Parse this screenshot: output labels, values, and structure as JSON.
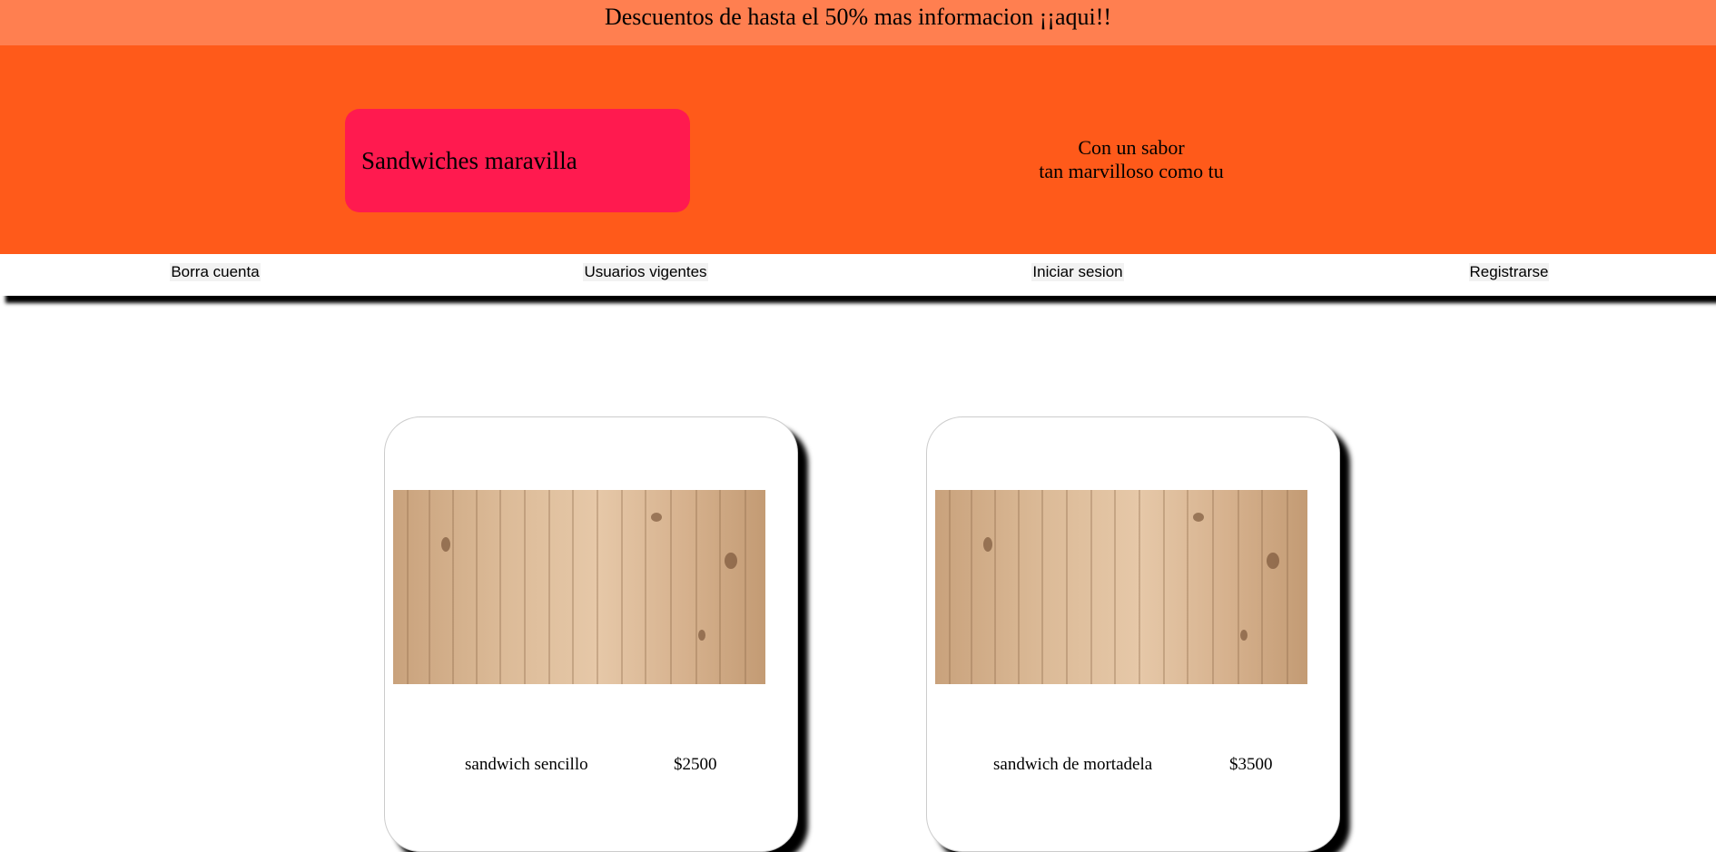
{
  "promo": {
    "text": "Descuentos de hasta el 50% mas informacion ¡¡aqui!!"
  },
  "header": {
    "brand": "Sandwiches maravilla",
    "tagline_line1": "Con un sabor",
    "tagline_line2": "tan marvilloso como tu"
  },
  "nav": {
    "items": [
      {
        "label": "Borra cuenta"
      },
      {
        "label": "Usuarios vigentes"
      },
      {
        "label": "Iniciar sesion"
      },
      {
        "label": "Registrarse"
      }
    ]
  },
  "products": [
    {
      "name": "sandwich sencillo",
      "price": "$2500",
      "image": "wood-texture-image"
    },
    {
      "name": "sandwich de mortadela",
      "price": "$3500",
      "image": "wood-texture-image"
    }
  ],
  "colors": {
    "promo_bg": "#ff7f50",
    "hero_bg": "#ff5a1a",
    "brand_box_bg": "#ff1a4f"
  }
}
